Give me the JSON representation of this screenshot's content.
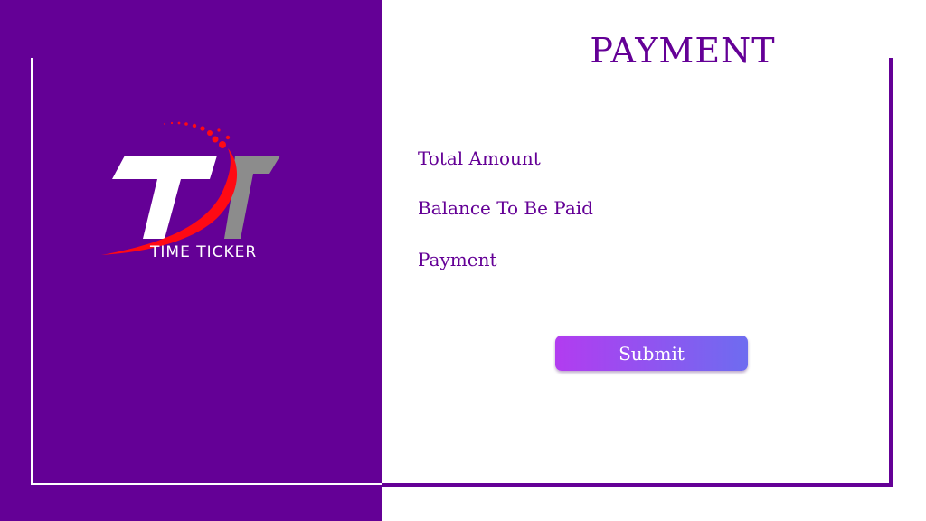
{
  "brand": {
    "logo_text": "TIME TICKER",
    "logo_letters": "TT"
  },
  "page": {
    "title": "PAYMENT"
  },
  "form": {
    "labels": {
      "total_amount": "Total Amount",
      "balance": "Balance To Be Paid",
      "payment": "Payment"
    },
    "submit_label": "Submit"
  },
  "colors": {
    "primary": "#640096",
    "logo_accent": "#ff0a14",
    "logo_grey": "#8c8c8c",
    "button_gradient_start": "#b23cf0",
    "button_gradient_end": "#6e6cf0"
  }
}
